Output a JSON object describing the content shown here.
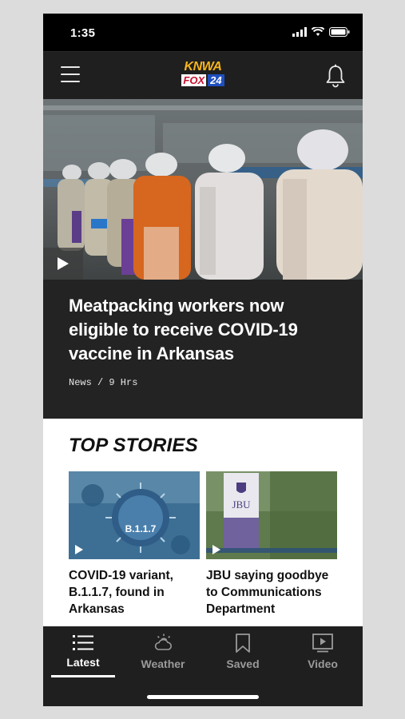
{
  "status_bar": {
    "time": "1:35"
  },
  "header": {
    "logo_top": "KNWA",
    "logo_fox": "FOX",
    "logo_24": "24"
  },
  "hero": {
    "headline": "Meatpacking workers now eligible to receive COVID-19 vaccine in Arkansas",
    "meta": "News / 9 Hrs"
  },
  "top_stories": {
    "title": "TOP STORIES",
    "items": [
      {
        "title": "COVID-19 variant, B.1.1.7, found in Arkansas",
        "thumb_label": "B.1.1.7"
      },
      {
        "title": "JBU saying goodbye to Communications Department",
        "thumb_label": "JBU"
      }
    ]
  },
  "nav": {
    "items": [
      {
        "label": "Latest",
        "icon": "list-icon",
        "active": true
      },
      {
        "label": "Weather",
        "icon": "weather-icon",
        "active": false
      },
      {
        "label": "Saved",
        "icon": "bookmark-icon",
        "active": false
      },
      {
        "label": "Video",
        "icon": "video-icon",
        "active": false
      }
    ]
  },
  "colors": {
    "header_bg": "#1f1f1f",
    "headline_bg": "#232323",
    "logo_gold": "#f6b51b",
    "logo_blue": "#1f4fbf"
  }
}
